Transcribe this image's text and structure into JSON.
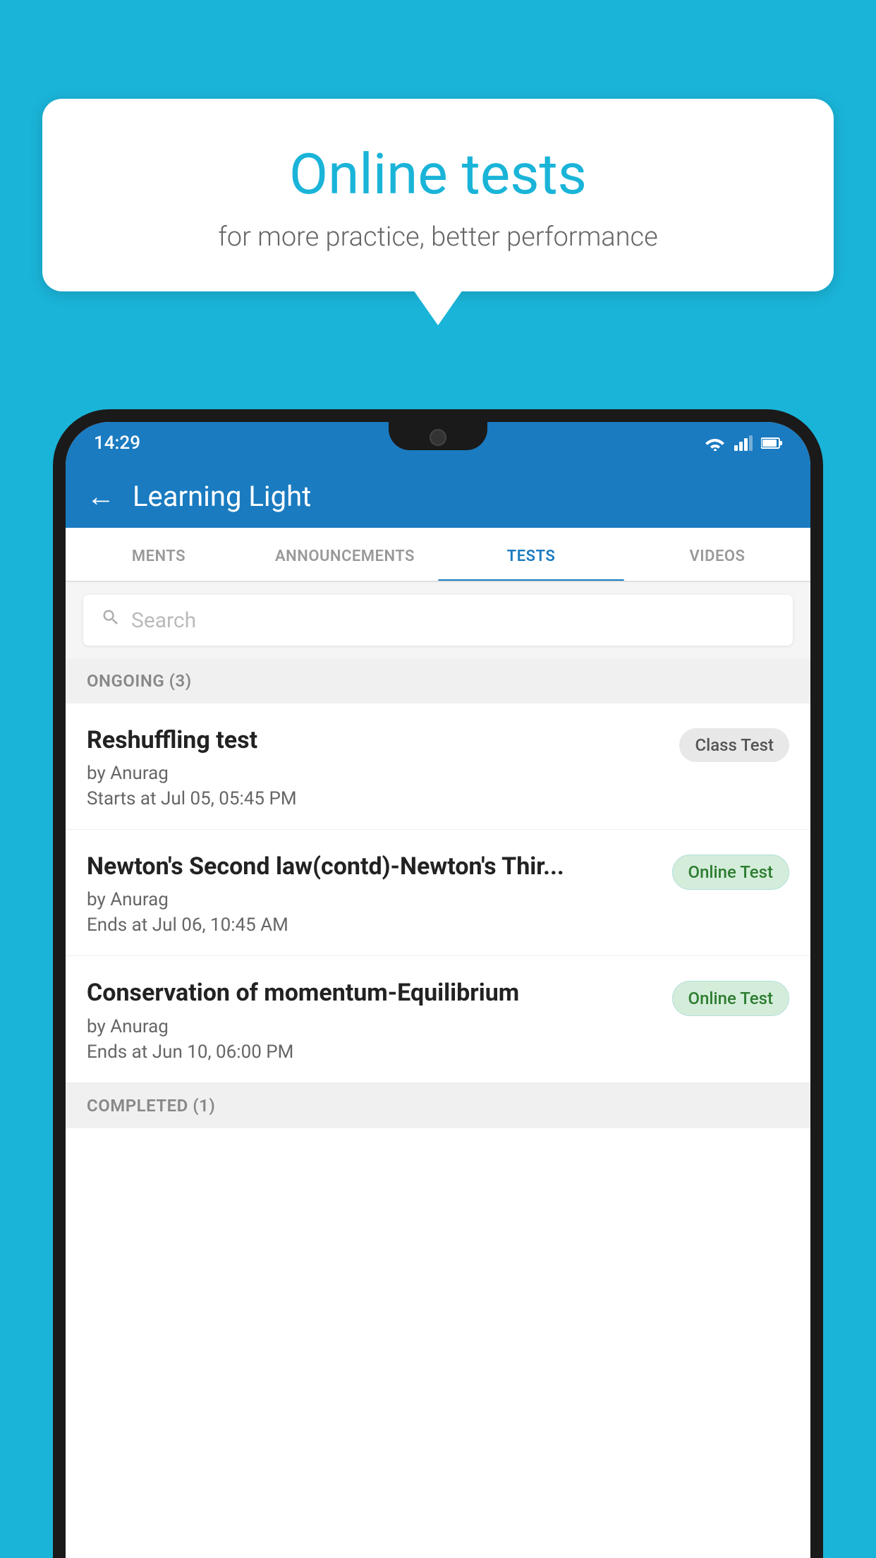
{
  "background": {
    "color": "#1ab4d8"
  },
  "speech_bubble": {
    "title": "Online tests",
    "subtitle": "for more practice, better performance"
  },
  "phone": {
    "status_bar": {
      "time": "14:29"
    },
    "app_bar": {
      "title": "Learning Light",
      "back_label": "←"
    },
    "tabs": [
      {
        "label": "MENTS",
        "active": false
      },
      {
        "label": "ANNOUNCEMENTS",
        "active": false
      },
      {
        "label": "TESTS",
        "active": true
      },
      {
        "label": "VIDEOS",
        "active": false
      }
    ],
    "search": {
      "placeholder": "Search"
    },
    "ongoing_section": {
      "label": "ONGOING (3)"
    },
    "tests": [
      {
        "name": "Reshuffling test",
        "author": "by Anurag",
        "time_label": "Starts at",
        "time": "Jul 05, 05:45 PM",
        "badge": "Class Test",
        "badge_type": "class"
      },
      {
        "name": "Newton's Second law(contd)-Newton's Thir...",
        "author": "by Anurag",
        "time_label": "Ends at",
        "time": "Jul 06, 10:45 AM",
        "badge": "Online Test",
        "badge_type": "online"
      },
      {
        "name": "Conservation of momentum-Equilibrium",
        "author": "by Anurag",
        "time_label": "Ends at",
        "time": "Jun 10, 06:00 PM",
        "badge": "Online Test",
        "badge_type": "online"
      }
    ],
    "completed_section": {
      "label": "COMPLETED (1)"
    }
  }
}
